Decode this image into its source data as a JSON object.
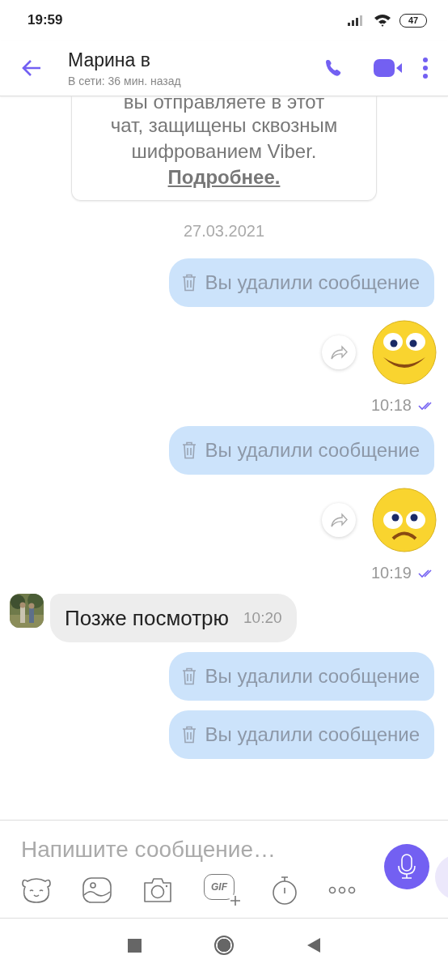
{
  "status_bar": {
    "time": "19:59",
    "battery": "47"
  },
  "header": {
    "title": "Марина в",
    "subtitle": "В сети: 36 мин. назад"
  },
  "info_card": {
    "lines": [
      "вы отправляете в этот",
      "чат, защищены сквозным",
      "шифрованием Viber."
    ],
    "link": "Подробнее."
  },
  "date": "27.03.2021",
  "messages": [
    {
      "kind": "deleted",
      "text": "Вы удалили сообщение"
    },
    {
      "kind": "sticker",
      "sticker": {
        "kind": "smile"
      },
      "time": "10:18",
      "read": true
    },
    {
      "kind": "deleted",
      "text": "Вы удалили сообщение"
    },
    {
      "kind": "sticker",
      "sticker": {
        "kind": "sad"
      },
      "time": "10:19",
      "read": true
    },
    {
      "kind": "incoming",
      "text": "Позже посмотрю",
      "time": "10:20"
    },
    {
      "kind": "deleted",
      "text": "Вы удалили сообщение"
    },
    {
      "kind": "deleted",
      "text": "Вы удалили сообщение"
    }
  ],
  "composer": {
    "placeholder": "Напишите сообщение…",
    "tools": [
      {
        "kind": "sticker"
      },
      {
        "kind": "gallery"
      },
      {
        "kind": "camera"
      },
      {
        "kind": "gif",
        "label": "GIF"
      },
      {
        "kind": "timer"
      },
      {
        "kind": "more"
      }
    ]
  }
}
